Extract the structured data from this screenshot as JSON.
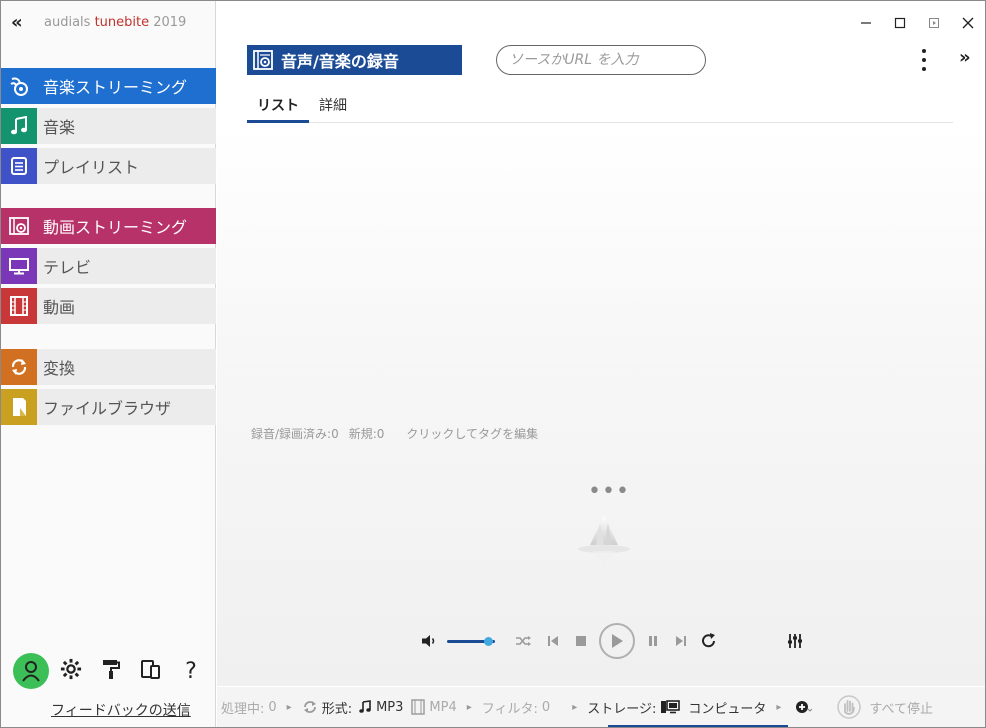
{
  "app": {
    "brand_prefix": "audials ",
    "brand_name": "tunebite",
    "brand_year": " 2019",
    "collapse_symbol": "«",
    "expand_symbol": "»"
  },
  "colors": {
    "accent": "#1b4b94",
    "nav_music_streaming": "#1f6fd0",
    "nav_music": "#14946e",
    "nav_playlist": "#4052c8",
    "nav_video_streaming": "#b8326a",
    "nav_tv": "#7a38b8",
    "nav_video": "#c83838",
    "nav_convert": "#d07020",
    "nav_filebrowser": "#c9a020",
    "avatar": "#3cbf56"
  },
  "sidebar": {
    "items": [
      {
        "label": "音楽ストリーミング",
        "icon": "music-streaming-icon"
      },
      {
        "label": "音楽",
        "icon": "music-note-icon"
      },
      {
        "label": "プレイリスト",
        "icon": "playlist-icon"
      },
      {
        "label": "動画ストリーミング",
        "icon": "video-streaming-icon"
      },
      {
        "label": "テレビ",
        "icon": "tv-icon"
      },
      {
        "label": "動画",
        "icon": "film-icon"
      },
      {
        "label": "変換",
        "icon": "convert-icon"
      },
      {
        "label": "ファイルブラウザ",
        "icon": "file-browser-icon"
      }
    ],
    "bottom_icons": [
      "user-avatar-icon",
      "gear-icon",
      "paint-roller-icon",
      "devices-icon",
      "help-icon"
    ],
    "help_symbol": "?",
    "feedback_label": "フィードバックの送信"
  },
  "header": {
    "title": "音声/音楽の録音",
    "search_placeholder": "ソースかURL を入力"
  },
  "tabs": [
    {
      "label": "リスト",
      "active": true
    },
    {
      "label": "詳細",
      "active": false
    }
  ],
  "content": {
    "recorded_label": "録音/録画済み:",
    "recorded_count": "0",
    "new_label": "新規:",
    "new_count": "0",
    "edit_tags_label": "クリックしてタグを編集",
    "loading_dots": "•••"
  },
  "statusbar": {
    "processing_label": "処理中:",
    "processing_count": "0",
    "format_label": "形式:",
    "format_mp3": "MP3",
    "format_mp4": "MP4",
    "filter_label": "フィルタ:",
    "filter_count": "0",
    "storage_label": "ストレージ:",
    "storage_value": "コンピュータ",
    "stop_all_label": "すべて停止"
  },
  "player": {
    "volume_level": 0.85
  }
}
